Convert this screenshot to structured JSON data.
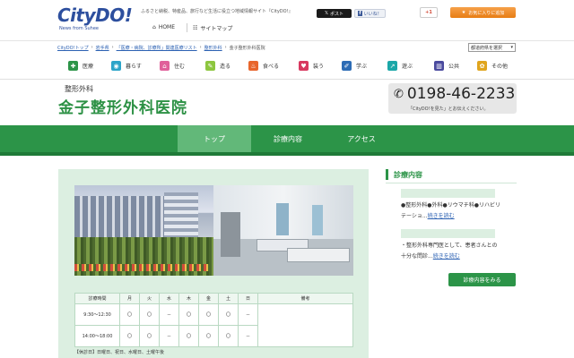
{
  "header": {
    "logo_text": "CityDO!",
    "logo_sub": "News from Suhee",
    "tagline": "ふるさと納税、特産品、旅行など生活に役立つ地域情報サイト『CityDO!』",
    "home_label": "HOME",
    "sitemap_label": "サイトマップ",
    "post_label": "ポスト",
    "like_label": "いいね！",
    "gplus_label": "+1",
    "favorite_label": "お気に入りに追加"
  },
  "breadcrumb": {
    "items": [
      "CityDO!トップ",
      "岩手県",
      "「医療・病院、診療所」関連医療リスト",
      "整形外科"
    ],
    "current": "金子整形外科医院",
    "separator": "›"
  },
  "pref_select": {
    "value": "都道府県を選択"
  },
  "categories": [
    {
      "label": "医療",
      "icon": "hospital-icon",
      "color": "#2c9448"
    },
    {
      "label": "暮らす",
      "icon": "home-life-icon",
      "color": "#2ba4c9"
    },
    {
      "label": "住む",
      "icon": "house-icon",
      "color": "#e0609a"
    },
    {
      "label": "造る",
      "icon": "build-icon",
      "color": "#8dc63f"
    },
    {
      "label": "食べる",
      "icon": "food-icon",
      "color": "#e8662c"
    },
    {
      "label": "装う",
      "icon": "fashion-icon",
      "color": "#d8385f"
    },
    {
      "label": "学ぶ",
      "icon": "study-icon",
      "color": "#2d6cb5"
    },
    {
      "label": "遊ぶ",
      "icon": "play-icon",
      "color": "#1ba7a8"
    },
    {
      "label": "公共",
      "icon": "public-icon",
      "color": "#4a4a9e"
    },
    {
      "label": "その他",
      "icon": "other-icon",
      "color": "#e0a51e"
    }
  ],
  "page": {
    "subtitle": "整形外科",
    "title": "金子整形外科医院",
    "phone": "0198-46-2233",
    "phone_note": "「CityDO!を見た」とお伝えください。"
  },
  "tabs": [
    {
      "label": "トップ",
      "active": true
    },
    {
      "label": "診療内容",
      "active": false
    },
    {
      "label": "アクセス",
      "active": false
    }
  ],
  "schedule": {
    "headers": [
      "診療時間",
      "月",
      "火",
      "水",
      "木",
      "金",
      "土",
      "日",
      "備考"
    ],
    "rows": [
      {
        "time": "9:30～12:30",
        "marks": [
          "〇",
          "〇",
          "－",
          "〇",
          "〇",
          "〇",
          "－"
        ],
        "remark": ""
      },
      {
        "time": "14:00～18:00",
        "marks": [
          "〇",
          "〇",
          "－",
          "〇",
          "〇",
          "〇",
          "－"
        ],
        "remark": ""
      }
    ],
    "note": "【休診日】日曜日、祝日、水曜日、土曜午後"
  },
  "sidebar": {
    "title": "診療内容",
    "items": [
      {
        "text": "●整形外科●外科●リウマチ科●リハビリテーショ...",
        "link": "続きを読む"
      },
      {
        "text": "・整形外科専門医として、患者さんとの十分な問診...",
        "link": "続きを読む"
      }
    ],
    "more_label": "診療内容をみる"
  }
}
